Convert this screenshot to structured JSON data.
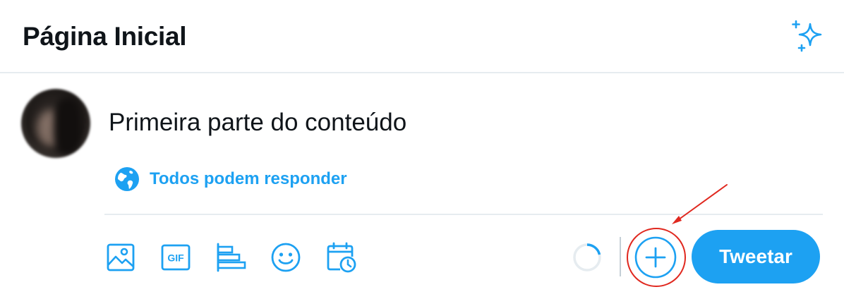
{
  "header": {
    "title": "Página Inicial",
    "sparkle_icon": "sparkle-icon"
  },
  "composer": {
    "avatar": "user-avatar",
    "text": "Primeira parte do conteúdo",
    "reply_setting": {
      "icon": "globe-icon",
      "label": "Todos podem responder"
    }
  },
  "toolbar": {
    "tools": [
      "image-icon",
      "gif-icon",
      "poll-icon",
      "emoji-icon",
      "schedule-icon"
    ],
    "gif_label": "GIF",
    "add_icon": "plus-icon",
    "tweet_label": "Tweetar"
  },
  "annotation": {
    "color": "#e0281f",
    "target": "add-thread-button"
  },
  "colors": {
    "accent": "#1da1f2",
    "text": "#0f1419",
    "border": "#e6ecf0"
  }
}
